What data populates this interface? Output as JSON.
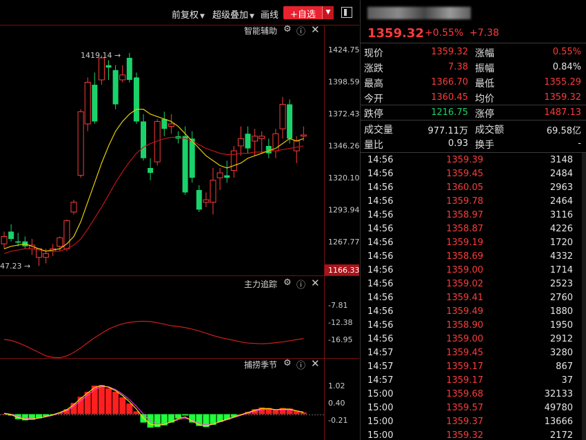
{
  "toolbar": {
    "adjust_label": "前复权",
    "overlay_label": "超级叠加",
    "draw_label": "画线",
    "favorite_label": "+自选"
  },
  "main_pane": {
    "title": "智能辅助",
    "high_annotation": "1419.14",
    "low_annotation": "47.23",
    "axis_labels": [
      "1424.75",
      "1398.59",
      "1372.43",
      "1346.26",
      "1320.10",
      "1293.94",
      "1267.77"
    ],
    "current_price_tag": "1166.33"
  },
  "trace_pane": {
    "title": "主力追踪",
    "axis_labels": [
      "-7.81",
      "-12.38",
      "-16.95"
    ]
  },
  "season_pane": {
    "title": "捕捞季节",
    "axis_labels": [
      "1.02",
      "0.40",
      "-0.21"
    ]
  },
  "colors": {
    "up": "#ff3b3b",
    "down": "#19d36a",
    "ma_short": "#e6d200",
    "ma_long": "#c0151b",
    "trace_line": "#cc1f1f"
  },
  "quote": {
    "price": "1359.32",
    "change_pct": "+0.55%",
    "change": "+7.38",
    "rows": [
      {
        "l1": "现价",
        "v1": "1359.32",
        "c1": "red",
        "l2": "涨幅",
        "v2": "0.55%",
        "c2": "red"
      },
      {
        "l1": "涨跌",
        "v1": "7.38",
        "c1": "red",
        "l2": "振幅",
        "v2": "0.84%",
        "c2": "white"
      },
      {
        "l1": "最高",
        "v1": "1366.70",
        "c1": "red",
        "l2": "最低",
        "v2": "1355.29",
        "c2": "red"
      },
      {
        "l1": "今开",
        "v1": "1360.45",
        "c1": "red",
        "l2": "均价",
        "v2": "1359.32",
        "c2": "red"
      },
      {
        "l1": "跌停",
        "v1": "1216.75",
        "c1": "green",
        "l2": "涨停",
        "v2": "1487.13",
        "c2": "red"
      },
      {
        "l1": "成交量",
        "v1": "977.11万",
        "c1": "white",
        "l2": "成交额",
        "v2": "69.58亿",
        "c2": "white"
      },
      {
        "l1": "量比",
        "v1": "0.93",
        "c1": "white",
        "l2": "换手",
        "v2": "-",
        "c2": "white"
      }
    ],
    "ticks": [
      {
        "time": "14:56",
        "price": "1359.39",
        "vol": "3148"
      },
      {
        "time": "14:56",
        "price": "1359.45",
        "vol": "2484"
      },
      {
        "time": "14:56",
        "price": "1360.05",
        "vol": "2963"
      },
      {
        "time": "14:56",
        "price": "1359.78",
        "vol": "2464"
      },
      {
        "time": "14:56",
        "price": "1358.97",
        "vol": "3116"
      },
      {
        "time": "14:56",
        "price": "1358.87",
        "vol": "4226"
      },
      {
        "time": "14:56",
        "price": "1359.19",
        "vol": "1720"
      },
      {
        "time": "14:56",
        "price": "1358.69",
        "vol": "4332"
      },
      {
        "time": "14:56",
        "price": "1359.00",
        "vol": "1714"
      },
      {
        "time": "14:56",
        "price": "1359.02",
        "vol": "2523"
      },
      {
        "time": "14:56",
        "price": "1359.41",
        "vol": "2760"
      },
      {
        "time": "14:56",
        "price": "1359.49",
        "vol": "1880"
      },
      {
        "time": "14:56",
        "price": "1358.90",
        "vol": "1950"
      },
      {
        "time": "14:56",
        "price": "1359.00",
        "vol": "2912"
      },
      {
        "time": "14:57",
        "price": "1359.45",
        "vol": "3280"
      },
      {
        "time": "14:57",
        "price": "1359.17",
        "vol": "867"
      },
      {
        "time": "14:57",
        "price": "1359.17",
        "vol": "37"
      },
      {
        "time": "15:00",
        "price": "1359.68",
        "vol": "32133"
      },
      {
        "time": "15:00",
        "price": "1359.57",
        "vol": "49780"
      },
      {
        "time": "15:00",
        "price": "1359.37",
        "vol": "13666"
      },
      {
        "time": "15:00",
        "price": "1359.32",
        "vol": "2172"
      }
    ]
  },
  "candles": [
    {
      "o": 1266,
      "h": 1276,
      "l": 1262,
      "c": 1272
    },
    {
      "o": 1276,
      "h": 1282,
      "l": 1268,
      "c": 1270
    },
    {
      "o": 1268,
      "h": 1275,
      "l": 1264,
      "c": 1267
    },
    {
      "o": 1268,
      "h": 1272,
      "l": 1262,
      "c": 1264
    },
    {
      "o": 1262,
      "h": 1270,
      "l": 1257,
      "c": 1265
    },
    {
      "o": 1255,
      "h": 1262,
      "l": 1248,
      "c": 1262
    },
    {
      "o": 1255,
      "h": 1262,
      "l": 1250,
      "c": 1258
    },
    {
      "o": 1260,
      "h": 1266,
      "l": 1256,
      "c": 1262
    },
    {
      "o": 1264,
      "h": 1272,
      "l": 1260,
      "c": 1271
    },
    {
      "o": 1262,
      "h": 1286,
      "l": 1260,
      "c": 1285
    },
    {
      "o": 1292,
      "h": 1302,
      "l": 1290,
      "c": 1300
    },
    {
      "o": 1322,
      "h": 1376,
      "l": 1320,
      "c": 1374
    },
    {
      "o": 1364,
      "h": 1402,
      "l": 1358,
      "c": 1398
    },
    {
      "o": 1396,
      "h": 1406,
      "l": 1364,
      "c": 1366
    },
    {
      "o": 1400,
      "h": 1420,
      "l": 1396,
      "c": 1418
    },
    {
      "o": 1412,
      "h": 1416,
      "l": 1400,
      "c": 1410
    },
    {
      "o": 1408,
      "h": 1412,
      "l": 1376,
      "c": 1380
    },
    {
      "o": 1400,
      "h": 1412,
      "l": 1398,
      "c": 1404
    },
    {
      "o": 1418,
      "h": 1422,
      "l": 1398,
      "c": 1400
    },
    {
      "o": 1402,
      "h": 1406,
      "l": 1364,
      "c": 1366
    },
    {
      "o": 1366,
      "h": 1372,
      "l": 1334,
      "c": 1336
    },
    {
      "o": 1328,
      "h": 1336,
      "l": 1318,
      "c": 1324
    },
    {
      "o": 1333,
      "h": 1368,
      "l": 1330,
      "c": 1366
    },
    {
      "o": 1368,
      "h": 1374,
      "l": 1354,
      "c": 1360
    },
    {
      "o": 1362,
      "h": 1372,
      "l": 1356,
      "c": 1364
    },
    {
      "o": 1354,
      "h": 1358,
      "l": 1348,
      "c": 1352
    },
    {
      "o": 1354,
      "h": 1362,
      "l": 1306,
      "c": 1308
    },
    {
      "o": 1352,
      "h": 1358,
      "l": 1316,
      "c": 1320
    },
    {
      "o": 1310,
      "h": 1314,
      "l": 1292,
      "c": 1294
    },
    {
      "o": 1300,
      "h": 1308,
      "l": 1296,
      "c": 1302
    },
    {
      "o": 1300,
      "h": 1328,
      "l": 1290,
      "c": 1318
    },
    {
      "o": 1320,
      "h": 1328,
      "l": 1310,
      "c": 1324
    },
    {
      "o": 1322,
      "h": 1334,
      "l": 1316,
      "c": 1320
    },
    {
      "o": 1326,
      "h": 1346,
      "l": 1320,
      "c": 1342
    },
    {
      "o": 1346,
      "h": 1362,
      "l": 1338,
      "c": 1352
    },
    {
      "o": 1356,
      "h": 1362,
      "l": 1340,
      "c": 1344
    },
    {
      "o": 1350,
      "h": 1360,
      "l": 1338,
      "c": 1354
    },
    {
      "o": 1352,
      "h": 1358,
      "l": 1340,
      "c": 1354
    },
    {
      "o": 1346,
      "h": 1352,
      "l": 1336,
      "c": 1340
    },
    {
      "o": 1342,
      "h": 1360,
      "l": 1336,
      "c": 1356
    },
    {
      "o": 1360,
      "h": 1386,
      "l": 1352,
      "c": 1380
    },
    {
      "o": 1380,
      "h": 1384,
      "l": 1348,
      "c": 1352
    },
    {
      "o": 1342,
      "h": 1354,
      "l": 1332,
      "c": 1350
    },
    {
      "o": 1354,
      "h": 1362,
      "l": 1350,
      "c": 1355
    }
  ],
  "ma_short": [
    1262,
    1264,
    1265,
    1266,
    1264,
    1262,
    1260,
    1261,
    1262,
    1266,
    1272,
    1284,
    1300,
    1316,
    1332,
    1346,
    1358,
    1366,
    1372,
    1376,
    1376,
    1372,
    1370,
    1368,
    1366,
    1362,
    1356,
    1350,
    1344,
    1338,
    1334,
    1330,
    1328,
    1330,
    1332,
    1336,
    1338,
    1340,
    1342,
    1344,
    1348,
    1352,
    1350,
    1352
  ],
  "ma_long": [
    1258,
    1260,
    1261,
    1262,
    1262,
    1261,
    1260,
    1260,
    1260,
    1262,
    1265,
    1270,
    1278,
    1287,
    1296,
    1306,
    1316,
    1325,
    1333,
    1340,
    1345,
    1348,
    1350,
    1352,
    1353,
    1353,
    1352,
    1350,
    1347,
    1344,
    1342,
    1340,
    1339,
    1339,
    1340,
    1340,
    1341,
    1341,
    1342,
    1342,
    1343,
    1344,
    1345,
    1346
  ],
  "trace_line": [
    -16.95,
    -17.2,
    -17.8,
    -18.6,
    -19.5,
    -20.4,
    -21.3,
    -21.7,
    -21.8,
    -21.3,
    -20.4,
    -19.2,
    -17.8,
    -16.5,
    -15.3,
    -14.2,
    -13.4,
    -12.8,
    -12.4,
    -12.2,
    -12.1,
    -12.2,
    -12.5,
    -12.9,
    -13.3,
    -13.5,
    -13.8,
    -14.2,
    -14.7,
    -15.3,
    -15.9,
    -16.4,
    -16.8,
    -17.2,
    -17.6,
    -17.9,
    -18.0,
    -18.1,
    -18.0,
    -17.8,
    -17.6,
    -17.3,
    -17.0,
    -16.7
  ],
  "season_bars": [
    0,
    -0.05,
    -0.18,
    -0.22,
    -0.2,
    -0.15,
    -0.08,
    -0.02,
    0.05,
    0.18,
    0.4,
    0.62,
    0.8,
    1.02,
    1.04,
    0.92,
    0.8,
    0.6,
    0.38,
    0.1,
    -0.3,
    -0.48,
    -0.46,
    -0.4,
    -0.3,
    -0.15,
    -0.05,
    -0.3,
    -0.42,
    -0.46,
    -0.38,
    -0.28,
    -0.2,
    -0.1,
    0.0,
    0.08,
    0.18,
    0.24,
    0.22,
    0.16,
    0.22,
    0.2,
    0.12,
    0.06
  ],
  "season_line": [
    0.02,
    -0.02,
    -0.12,
    -0.18,
    -0.18,
    -0.14,
    -0.08,
    -0.02,
    0.06,
    0.16,
    0.34,
    0.56,
    0.76,
    0.95,
    1.02,
    0.96,
    0.84,
    0.66,
    0.44,
    0.18,
    -0.14,
    -0.36,
    -0.4,
    -0.36,
    -0.28,
    -0.16,
    -0.1,
    -0.24,
    -0.38,
    -0.42,
    -0.36,
    -0.26,
    -0.18,
    -0.1,
    -0.02,
    0.06,
    0.14,
    0.2,
    0.2,
    0.16,
    0.18,
    0.18,
    0.12,
    0.06
  ],
  "season_line2": [
    0.04,
    0.0,
    -0.08,
    -0.14,
    -0.16,
    -0.14,
    -0.1,
    -0.04,
    0.04,
    0.12,
    0.28,
    0.48,
    0.68,
    0.88,
    0.98,
    0.98,
    0.88,
    0.72,
    0.52,
    0.28,
    0.0,
    -0.24,
    -0.34,
    -0.34,
    -0.28,
    -0.2,
    -0.14,
    -0.22,
    -0.32,
    -0.38,
    -0.34,
    -0.28,
    -0.2,
    -0.12,
    -0.04,
    0.04,
    0.1,
    0.16,
    0.18,
    0.16,
    0.16,
    0.16,
    0.12,
    0.08
  ]
}
